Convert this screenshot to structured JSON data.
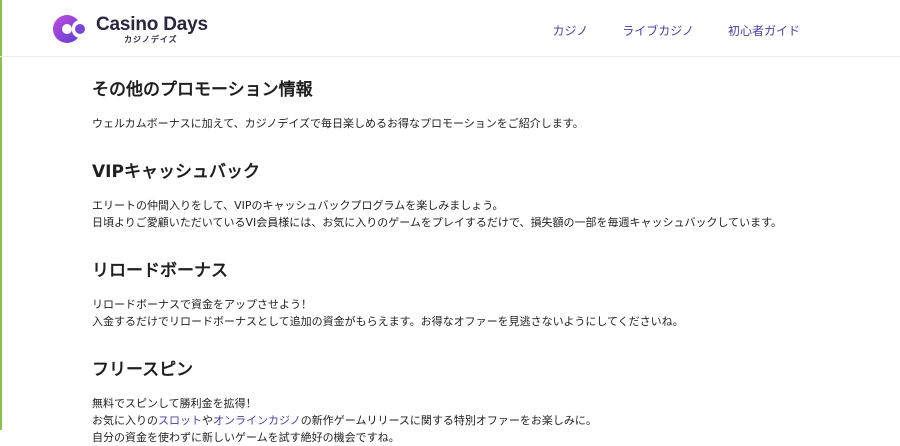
{
  "brand": {
    "name": "Casino Days",
    "sub": "カジノデイズ"
  },
  "nav": [
    "カジノ",
    "ライブカジノ",
    "初心者ガイド"
  ],
  "sections": [
    {
      "title": "その他のプロモーション情報",
      "lines": [
        "ウェルカムボーナスに加えて、カジノデイズで毎日楽しめるお得なプロモーションをご紹介します。"
      ]
    },
    {
      "title": "VIPキャッシュバック",
      "lines": [
        "エリートの仲間入りをして、VIPのキャッシュバックプログラムを楽しみましょう。",
        "日頃よりご愛顧いただいているVI会員様には、お気に入りのゲームをプレイするだけで、損失額の一部を毎週キャッシュバックしています。"
      ]
    },
    {
      "title": "リロードボーナス",
      "lines": [
        "リロードボーナスで資金をアップさせよう！",
        "入金するだけでリロードボーナスとして追加の資金がもらえます。お得なオファーを見逃さないようにしてくださいね。"
      ]
    },
    {
      "title": "フリースピン",
      "lines": [
        "無料でスピンして勝利金を拡得！"
      ],
      "line2": {
        "pre": "お気に入りの",
        "link1": "スロット",
        "mid": "や",
        "link2": "オンラインカジノ",
        "post": "の新作ゲームリリースに関する特別オファーをお楽しみに。"
      },
      "line3": "自分の資金を使わずに新しいゲームを試す絶好の機会ですね。"
    }
  ]
}
